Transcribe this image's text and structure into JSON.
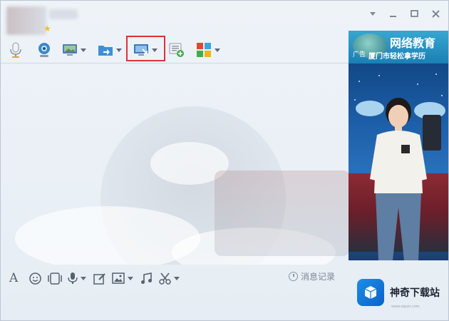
{
  "window": {
    "star_icon": "star-icon",
    "controls": {
      "menu_icon": "chevron-down-icon",
      "minimize_icon": "minimize-icon",
      "maximize_icon": "maximize-icon",
      "close_icon": "close-icon"
    }
  },
  "toolbar": {
    "items": [
      {
        "icon": "microphone-icon",
        "has_dropdown": false
      },
      {
        "icon": "webcam-icon",
        "has_dropdown": false
      },
      {
        "icon": "screen-icon",
        "has_dropdown": true
      },
      {
        "icon": "folder-send-icon",
        "has_dropdown": true
      },
      {
        "icon": "remote-desktop-icon",
        "has_dropdown": true,
        "highlighted": true,
        "highlight_color": "#e0303a"
      },
      {
        "icon": "add-message-icon",
        "has_dropdown": false
      },
      {
        "icon": "apps-grid-icon",
        "has_dropdown": true
      }
    ]
  },
  "format_bar": {
    "items": [
      {
        "icon": "font-icon"
      },
      {
        "icon": "emoji-icon"
      },
      {
        "icon": "magic-expression-icon"
      },
      {
        "icon": "voice-icon",
        "has_dropdown": true
      },
      {
        "icon": "edit-image-icon"
      },
      {
        "icon": "picture-icon",
        "has_dropdown": true
      },
      {
        "icon": "music-icon"
      },
      {
        "icon": "scissors-icon",
        "has_dropdown": true
      }
    ],
    "history_label": "消息记录",
    "history_icon": "clock-icon"
  },
  "ad": {
    "tag": "广告",
    "title": "网络教育",
    "subtitle": "厦门市轻松拿学历"
  },
  "watermark": {
    "text": "神奇下载站",
    "url": "www.sqxzz.com"
  },
  "colors": {
    "accent_red": "#e0303a",
    "ad_blue": "#1d5ea8",
    "watermark_blue": "#1b8ee6"
  }
}
